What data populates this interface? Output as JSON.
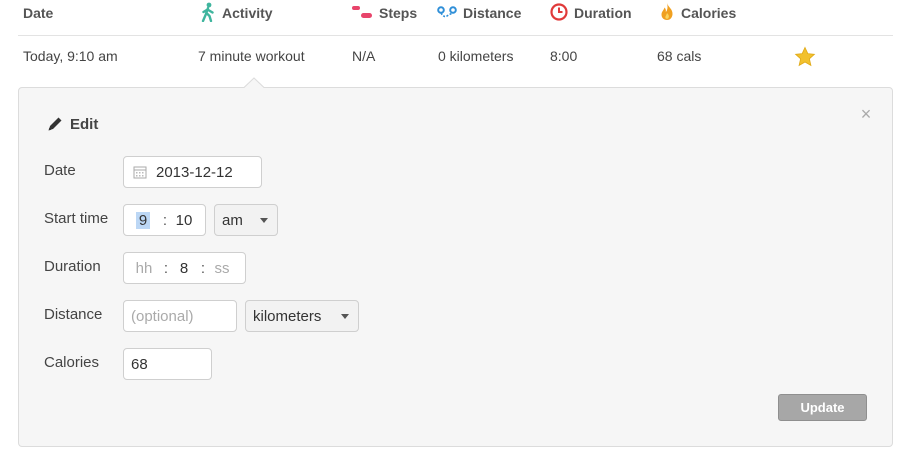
{
  "columns": {
    "date": "Date",
    "activity": "Activity",
    "steps": "Steps",
    "distance": "Distance",
    "duration": "Duration",
    "calories": "Calories"
  },
  "icons": {
    "activity": "walking-person-icon",
    "steps": "footsteps-icon",
    "distance": "route-icon",
    "duration": "clock-icon",
    "calories": "flame-icon",
    "favorite": "star-icon",
    "edit": "pencil-icon",
    "close": "close-icon",
    "calendar": "calendar-icon"
  },
  "row": {
    "date": "Today, 9:10 am",
    "activity": "7 minute workout",
    "steps": "N/A",
    "distance": "0 kilometers",
    "duration": "8:00",
    "calories": "68 cals",
    "favorite": true
  },
  "edit": {
    "title": "Edit",
    "close_glyph": "×",
    "fields": {
      "date_label": "Date",
      "date_value": "2013-12-12",
      "start_label": "Start time",
      "start_hour": "9",
      "start_sep": ":",
      "start_minute": "10",
      "start_ampm": "am",
      "duration_label": "Duration",
      "duration_hh_placeholder": "hh",
      "duration_min": "8",
      "duration_ss_placeholder": "ss",
      "duration_sep": ":",
      "distance_label": "Distance",
      "distance_placeholder": "(optional)",
      "distance_unit": "kilometers",
      "calories_label": "Calories",
      "calories_value": "68"
    },
    "update_label": "Update"
  },
  "colors": {
    "activity_icon": "#3fb59e",
    "steps_icon": "#e8446b",
    "distance_icon": "#2f8fd8",
    "duration_icon": "#e03a3a",
    "calories_icon": "#f0a020",
    "star": "#f2c12e",
    "update_button": "#a7a7a7",
    "panel_bg": "#f6f6f6"
  }
}
